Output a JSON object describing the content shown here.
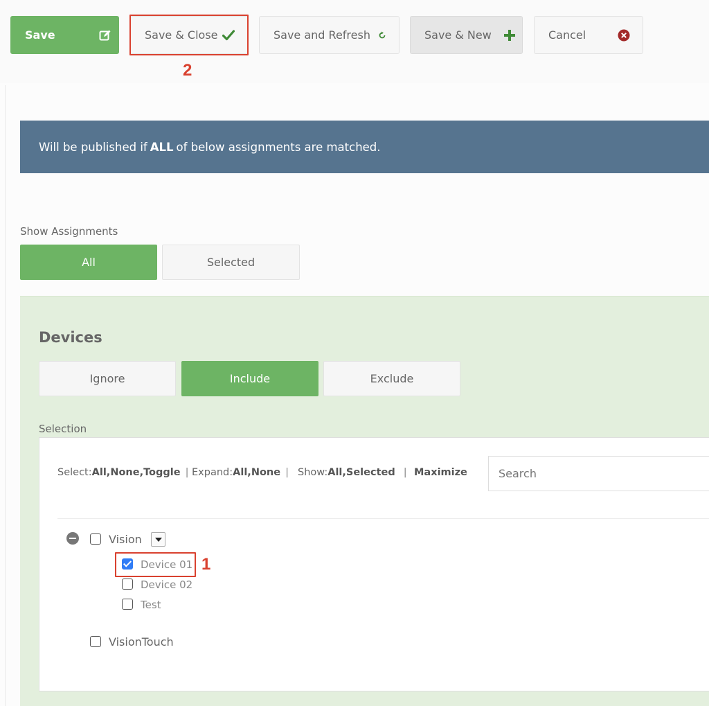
{
  "toolbar": {
    "save_label": "Save",
    "save_close_label": "Save & Close",
    "save_refresh_label": "Save and Refresh",
    "save_new_label": "Save & New",
    "cancel_label": "Cancel"
  },
  "callouts": {
    "save_close_number": "2",
    "device01_number": "1"
  },
  "banner": {
    "pre": "Will be published if",
    "bold": "ALL",
    "post": "of below assignments are matched."
  },
  "show_assignments": {
    "label": "Show Assignments",
    "options": [
      "All",
      "Selected"
    ],
    "selected": "All"
  },
  "devices": {
    "title": "Devices",
    "modes": [
      "Ignore",
      "Include",
      "Exclude"
    ],
    "selected_mode": "Include",
    "selection_label": "Selection"
  },
  "tree_tools": {
    "select_prefix": "Select:",
    "select_all": "All",
    "select_none": "None",
    "select_toggle": "Toggle",
    "expand_prefix": "Expand:",
    "expand_all": "All",
    "expand_none": "None",
    "show_prefix": "Show:",
    "show_all": "All",
    "show_selected": "Selected",
    "maximize": "Maximize",
    "separator": "|",
    "comma": ","
  },
  "search": {
    "placeholder": "Search"
  },
  "tree": {
    "groups": [
      {
        "label": "Vision",
        "expanded": true,
        "checked": false,
        "children": [
          {
            "label": "Device 01",
            "checked": true
          },
          {
            "label": "Device 02",
            "checked": false
          },
          {
            "label": "Test",
            "checked": false
          }
        ]
      },
      {
        "label": "VisionTouch",
        "expanded": false,
        "checked": false,
        "children": []
      }
    ]
  },
  "colors": {
    "primary_green": "#6db464",
    "banner_blue": "#56748f",
    "panel_green": "#e3efdd",
    "callout_red": "#d9412f",
    "check_blue": "#2f7cf6",
    "cancel_red": "#a32a2a"
  },
  "icons": {
    "save": "edit-icon",
    "save_close": "checkmark-icon",
    "save_refresh": "refresh-icon",
    "save_new": "plus-icon",
    "cancel": "close-circle-icon",
    "collapse": "minus-circle-icon",
    "dropdown": "caret-down-icon"
  }
}
